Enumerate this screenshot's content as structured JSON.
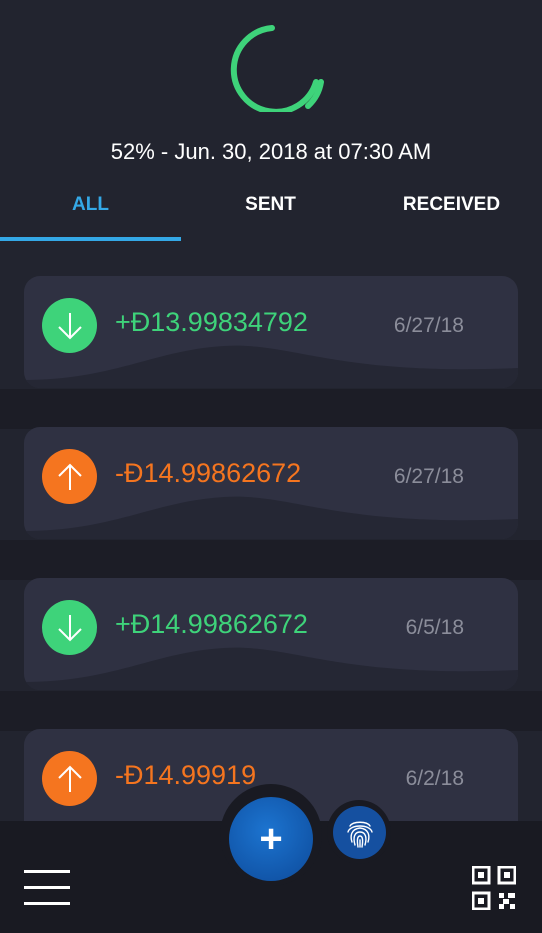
{
  "sync": {
    "status_text": "52% - Jun. 30, 2018 at 07:30 AM",
    "progress_percent": 52,
    "ring_color": "#3ed37a"
  },
  "tabs": [
    {
      "label": "ALL",
      "active": true
    },
    {
      "label": "SENT",
      "active": false
    },
    {
      "label": "RECEIVED",
      "active": false
    }
  ],
  "transactions": [
    {
      "direction": "received",
      "icon": "arrow-down-icon",
      "amount": "+Đ13.99834792",
      "date": "6/27/18"
    },
    {
      "direction": "sent",
      "icon": "arrow-up-icon",
      "amount": "-Đ14.99862672",
      "date": "6/27/18"
    },
    {
      "direction": "received",
      "icon": "arrow-down-icon",
      "amount": "+Đ14.99862672",
      "date": "6/5/18"
    },
    {
      "direction": "sent",
      "icon": "arrow-up-icon",
      "amount": "-Đ14.99919",
      "date": "6/2/18"
    }
  ],
  "bottom_bar": {
    "fab_symbol": "+",
    "menu_icon": "hamburger-menu-icon",
    "qr_icon": "qr-code-icon",
    "fingerprint_icon": "fingerprint-icon"
  },
  "colors": {
    "accent": "#34a8e6",
    "received": "#3ed37a",
    "sent": "#f5751f",
    "background": "#22242f",
    "card": "#2f3142"
  }
}
